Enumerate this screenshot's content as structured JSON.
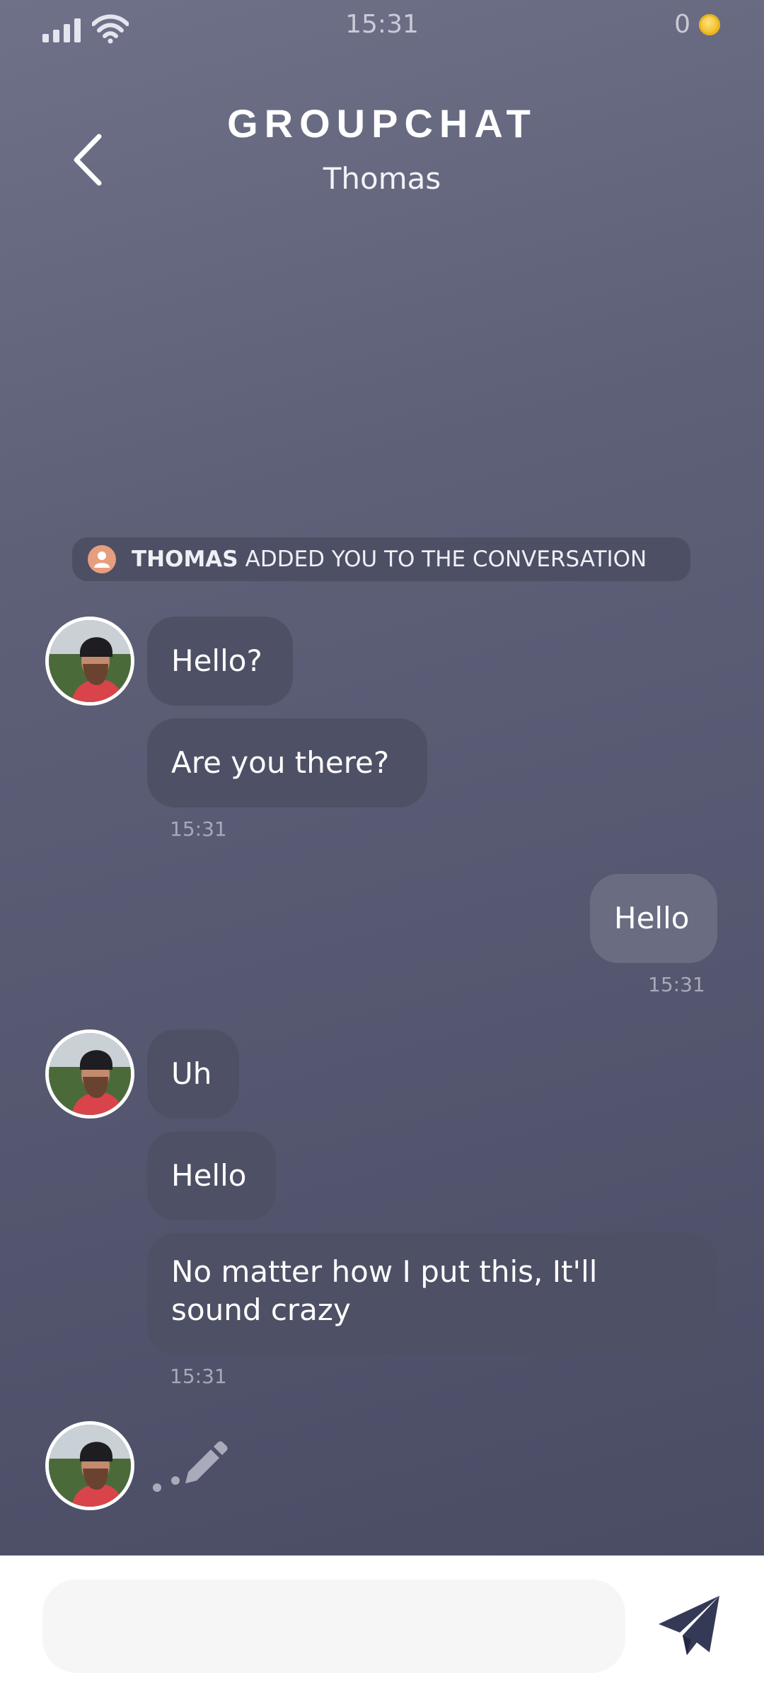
{
  "status_bar": {
    "time": "15:31",
    "coins": "0",
    "icons": [
      "signal-icon",
      "wifi-icon",
      "coin-icon"
    ]
  },
  "header": {
    "title": "GROUPCHAT",
    "subtitle": "Thomas",
    "back_icon": "chevron-left-icon"
  },
  "notice": {
    "name": "THOMAS",
    "text": "ADDED YOU TO THE CONVERSATION",
    "icon": "user-icon"
  },
  "messages": [
    {
      "sender": "other",
      "text": "Hello?"
    },
    {
      "sender": "other",
      "text": "Are you there?",
      "time": "15:31"
    },
    {
      "sender": "me",
      "text": "Hello",
      "time": "15:31"
    },
    {
      "sender": "other",
      "text": "Uh"
    },
    {
      "sender": "other",
      "text": "Hello"
    },
    {
      "sender": "other",
      "text": "No matter how I put this, It'll sound crazy",
      "time": "15:31"
    }
  ],
  "typing_indicator": {
    "icon": "pencil-icon"
  },
  "composer": {
    "placeholder": "",
    "send_icon": "send-icon"
  },
  "colors": {
    "bubble_other": "#4e5065",
    "bubble_me": "#6a6c82",
    "send_icon": "#343a55",
    "notice_avatar": "#e79e7e"
  }
}
